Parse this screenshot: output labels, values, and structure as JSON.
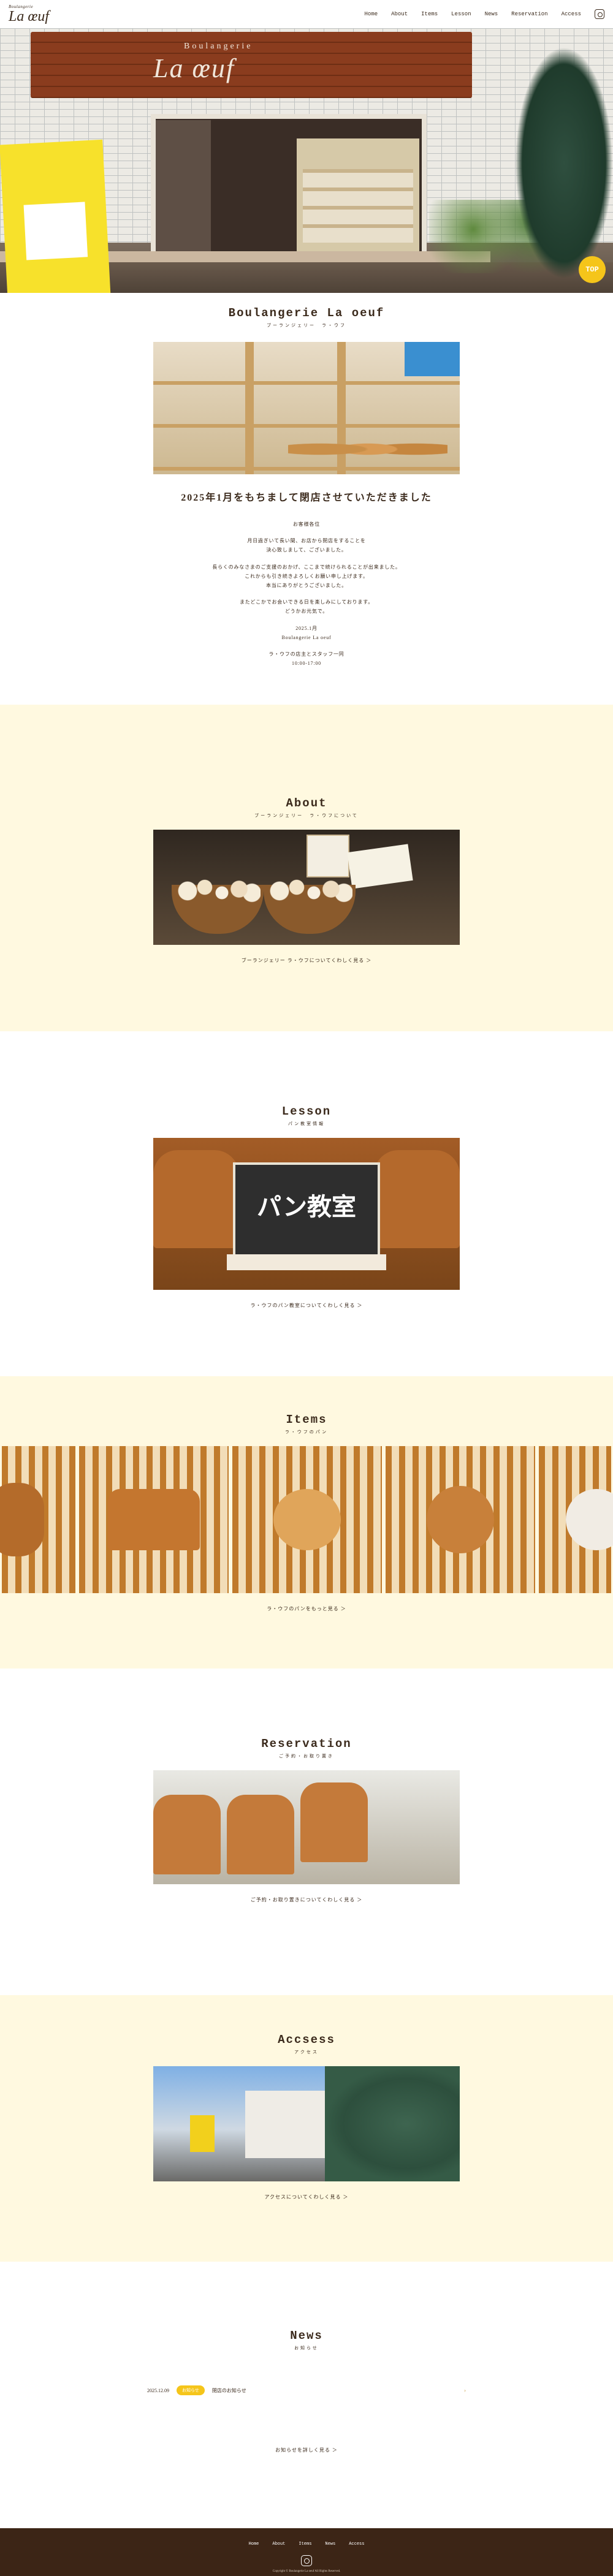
{
  "header": {
    "logo_small": "Boulangerie",
    "logo_main": "La œuf",
    "nav": [
      "Home",
      "About",
      "Items",
      "Lesson",
      "News",
      "Reservation",
      "Access"
    ]
  },
  "hero": {
    "sign_small": "Boulangerie",
    "sign_main": "La œuf",
    "top_button": "TOP"
  },
  "intro": {
    "title": "Boulangerie La oeuf",
    "subtitle": "ブーランジェリー　ラ・ウフ",
    "announcement": "2025年1月をもちまして閉店させていただきました",
    "message": [
      "お客様各位",
      "",
      "月日過ぎいて長い間、お店から閉店をすることを",
      "決心致しまして、ございました。",
      "",
      "長らくのみなさまのご支援のおかげ、ここまで続けられることが出来ました。",
      "これからも引き続きよろしくお願い申し上げます。",
      "本当にありがとうございました。",
      "",
      "またどこかでお会いできる日を楽しみにしております。",
      "どうかお元気で。",
      "",
      "2025.1月",
      "Boulangerie La oeuf",
      "",
      "ラ・ウフの店主とスタッフ一同",
      "10:00-17:00"
    ]
  },
  "about": {
    "title": "About",
    "subtitle": "ブーランジェリー　ラ・ウフについて",
    "caption": "ブーランジェリー ラ・ウフについてくわしく見る ＞"
  },
  "lesson": {
    "title": "Lesson",
    "subtitle": "パン教室情報",
    "banner_text": "パン教室",
    "caption": "ラ・ウフのパン教室についてくわしく見る ＞"
  },
  "items": {
    "title": "Items",
    "subtitle": "ラ・ウフのパン",
    "caption": "ラ・ウフのパンをもっと見る ＞"
  },
  "reservation": {
    "title": "Reservation",
    "subtitle": "ご予約・お取り置き",
    "caption": "ご予約・お取り置きについてくわしく見る ＞"
  },
  "access": {
    "title": "Accsess",
    "subtitle": "アクセス",
    "caption": "アクセスについてくわしく見る ＞"
  },
  "news": {
    "title": "News",
    "subtitle": "お知らせ",
    "items": [
      {
        "date": "2025.12.09",
        "badge": "お知らせ",
        "title": "閉店のお知らせ"
      }
    ],
    "more": "お知らせを詳しく見る ＞"
  },
  "footer": {
    "nav": [
      "Home",
      "About",
      "Items",
      "News",
      "Access"
    ],
    "copyright": "Copyright © Boulangerie La oeuf All Rights Reserved."
  },
  "colors": {
    "accent": "#f5c51a",
    "cream": "#fff9e0",
    "brown": "#3c2516"
  }
}
